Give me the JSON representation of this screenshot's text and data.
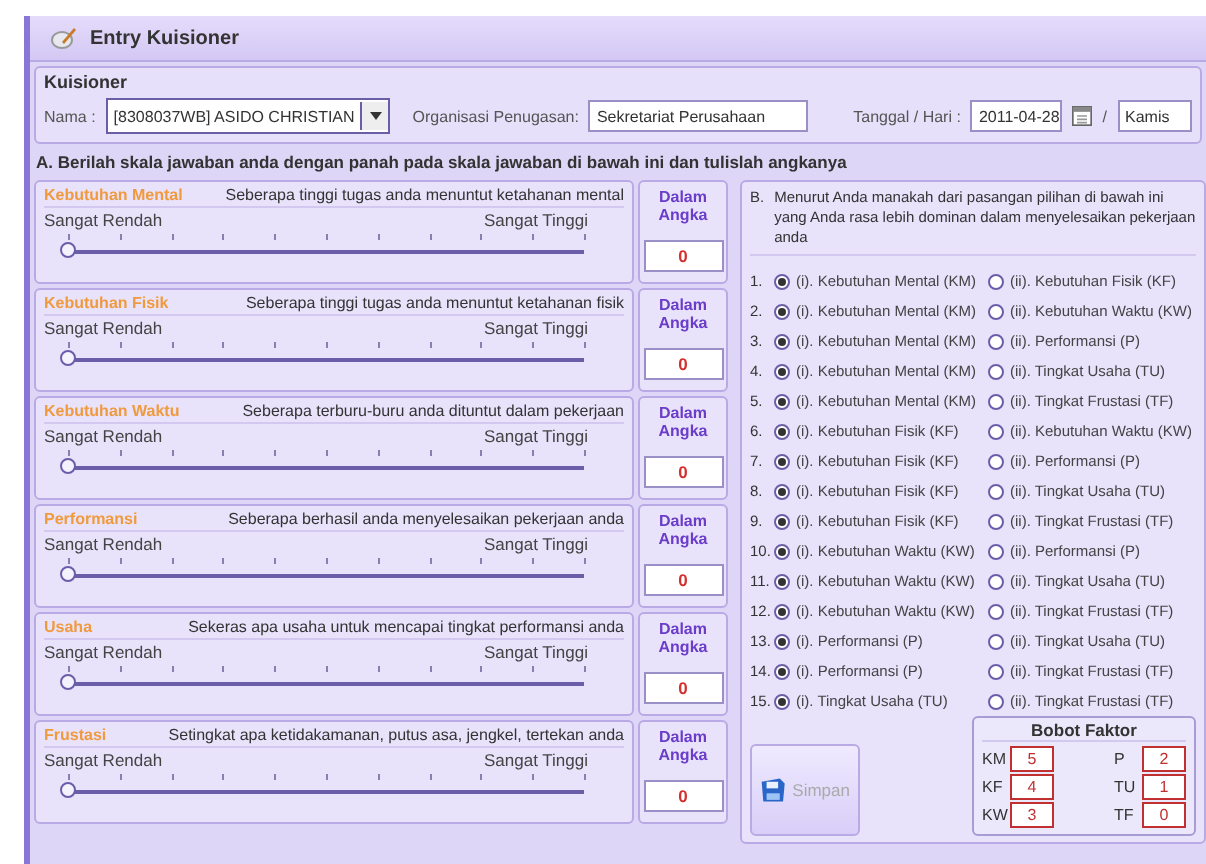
{
  "window": {
    "title": "Entry Kuisioner"
  },
  "kuisioner": {
    "title": "Kuisioner",
    "name_label": "Nama :",
    "name_value": "[8308037WB] ASIDO CHRISTIAN",
    "org_label": "Organisasi Penugasan:",
    "org_value": "Sekretariat Perusahaan",
    "date_label": "Tanggal / Hari :",
    "date_value": "2011-04-28",
    "separator": "/",
    "day_value": "Kamis"
  },
  "section_a": "A.  Berilah skala jawaban anda dengan panah pada skala jawaban di bawah ini dan tulislah angkanya",
  "factors": [
    {
      "name": "Kebutuhan Mental",
      "question": "Seberapa tinggi tugas anda menuntut ketahanan  mental",
      "low": "Sangat Rendah",
      "high": "Sangat Tinggi",
      "level": 0,
      "answer_label": "Dalam Angka",
      "value": "0"
    },
    {
      "name": "Kebutuhan Fisik",
      "question": "Seberapa tinggi tugas anda menuntut ketahanan fisik",
      "low": "Sangat Rendah",
      "high": "Sangat Tinggi",
      "level": 0,
      "answer_label": "Dalam Angka",
      "value": "0"
    },
    {
      "name": "Kebutuhan Waktu",
      "question": "Seberapa terburu-buru anda dituntut dalam pekerjaan",
      "low": "Sangat Rendah",
      "high": "Sangat Tinggi",
      "level": 0,
      "answer_label": "Dalam Angka",
      "value": "0"
    },
    {
      "name": "Performansi",
      "question": "Seberapa berhasil anda menyelesaikan pekerjaan anda",
      "low": "Sangat Rendah",
      "high": "Sangat Tinggi",
      "level": 0,
      "answer_label": "Dalam Angka",
      "value": "0"
    },
    {
      "name": "Usaha",
      "question": "Sekeras apa usaha  untuk mencapai tingkat performansi anda",
      "low": "Sangat Rendah",
      "high": "Sangat Tinggi",
      "level": 0,
      "answer_label": "Dalam Angka",
      "value": "0"
    },
    {
      "name": "Frustasi",
      "question": "Setingkat apa ketidakamanan, putus asa, jengkel, tertekan anda",
      "low": "Sangat Rendah",
      "high": "Sangat Tinggi",
      "level": 0,
      "answer_label": "Dalam Angka",
      "value": "0"
    }
  ],
  "section_b": {
    "marker": "B.",
    "instruction": "Menurut Anda manakah dari pasangan pilihan di bawah ini yang Anda rasa lebih dominan dalam menyelesaikan pekerjaan anda",
    "pairs": [
      {
        "number": "1.",
        "options": [
          {
            "label": "(i). Kebutuhan Mental (KM)",
            "selected": true
          },
          {
            "label": "(ii). Kebutuhan Fisik (KF)",
            "selected": false
          }
        ]
      },
      {
        "number": "2.",
        "options": [
          {
            "label": "(i). Kebutuhan Mental (KM)",
            "selected": true
          },
          {
            "label": "(ii). Kebutuhan Waktu (KW)",
            "selected": false
          }
        ]
      },
      {
        "number": "3.",
        "options": [
          {
            "label": "(i). Kebutuhan Mental (KM)",
            "selected": true
          },
          {
            "label": "(ii). Performansi (P)",
            "selected": false
          }
        ]
      },
      {
        "number": "4.",
        "options": [
          {
            "label": "(i). Kebutuhan Mental (KM)",
            "selected": true
          },
          {
            "label": "(ii). Tingkat Usaha (TU)",
            "selected": false
          }
        ]
      },
      {
        "number": "5.",
        "options": [
          {
            "label": "(i). Kebutuhan Mental (KM)",
            "selected": true
          },
          {
            "label": "(ii). Tingkat Frustasi (TF)",
            "selected": false
          }
        ]
      },
      {
        "number": "6.",
        "options": [
          {
            "label": "(i). Kebutuhan Fisik (KF)",
            "selected": true
          },
          {
            "label": "(ii). Kebutuhan Waktu (KW)",
            "selected": false
          }
        ]
      },
      {
        "number": "7.",
        "options": [
          {
            "label": "(i). Kebutuhan Fisik (KF)",
            "selected": true
          },
          {
            "label": "(ii). Performansi (P)",
            "selected": false
          }
        ]
      },
      {
        "number": "8.",
        "options": [
          {
            "label": "(i). Kebutuhan Fisik (KF)",
            "selected": true
          },
          {
            "label": "(ii). Tingkat Usaha (TU)",
            "selected": false
          }
        ]
      },
      {
        "number": "9.",
        "options": [
          {
            "label": "(i). Kebutuhan Fisik (KF)",
            "selected": true
          },
          {
            "label": "(ii). Tingkat Frustasi (TF)",
            "selected": false
          }
        ]
      },
      {
        "number": "10.",
        "options": [
          {
            "label": "(i). Kebutuhan Waktu (KW)",
            "selected": true
          },
          {
            "label": "(ii). Performansi (P)",
            "selected": false
          }
        ]
      },
      {
        "number": "11.",
        "options": [
          {
            "label": "(i). Kebutuhan Waktu (KW)",
            "selected": true
          },
          {
            "label": "(ii). Tingkat Usaha (TU)",
            "selected": false
          }
        ]
      },
      {
        "number": "12.",
        "options": [
          {
            "label": "(i). Kebutuhan Waktu (KW)",
            "selected": true
          },
          {
            "label": "(ii). Tingkat Frustasi (TF)",
            "selected": false
          }
        ]
      },
      {
        "number": "13.",
        "options": [
          {
            "label": "(i). Performansi (P)",
            "selected": true
          },
          {
            "label": "(ii). Tingkat Usaha (TU)",
            "selected": false
          }
        ]
      },
      {
        "number": "14.",
        "options": [
          {
            "label": "(i). Performansi (P)",
            "selected": true
          },
          {
            "label": "(ii). Tingkat Frustasi (TF)",
            "selected": false
          }
        ]
      },
      {
        "number": "15.",
        "options": [
          {
            "label": "(i). Tingkat Usaha (TU)",
            "selected": true
          },
          {
            "label": "(ii). Tingkat Frustasi (TF)",
            "selected": false
          }
        ]
      }
    ]
  },
  "save_button": {
    "label": "Simpan",
    "disabled": true
  },
  "bobot": {
    "title": "Bobot Faktor",
    "items": [
      {
        "label": "KM",
        "value": "5"
      },
      {
        "label": "P",
        "value": "2"
      },
      {
        "label": "KF",
        "value": "4"
      },
      {
        "label": "TU",
        "value": "1"
      },
      {
        "label": "KW",
        "value": "3"
      },
      {
        "label": "TF",
        "value": "0"
      }
    ]
  }
}
